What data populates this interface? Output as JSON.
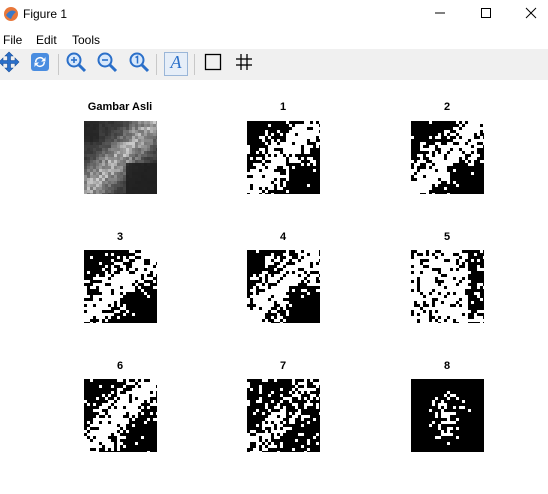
{
  "window": {
    "title": "Figure 1",
    "icons": {
      "app": "matlab-figure-icon",
      "minimize": "minimize-icon",
      "maximize": "maximize-icon",
      "close": "close-icon"
    }
  },
  "menu": {
    "items": [
      "File",
      "Edit",
      "Tools"
    ]
  },
  "toolbar": {
    "buttons": [
      {
        "name": "pan-icon"
      },
      {
        "name": "rotate-icon"
      },
      {
        "name": "zoom-in-icon"
      },
      {
        "name": "zoom-out-icon"
      },
      {
        "name": "reset-zoom-icon"
      },
      {
        "name": "text-tool-icon"
      },
      {
        "name": "box-icon"
      },
      {
        "name": "grid-icon"
      }
    ]
  },
  "figure": {
    "subplots": [
      {
        "title": "Gambar Asli",
        "kind": "grayscale"
      },
      {
        "title": "1",
        "kind": "binary"
      },
      {
        "title": "2",
        "kind": "binary"
      },
      {
        "title": "3",
        "kind": "binary"
      },
      {
        "title": "4",
        "kind": "binary"
      },
      {
        "title": "5",
        "kind": "binary"
      },
      {
        "title": "6",
        "kind": "binary"
      },
      {
        "title": "7",
        "kind": "binary"
      },
      {
        "title": "8",
        "kind": "binary"
      }
    ]
  },
  "colors": {
    "toolbar_bg": "#f0f0f0",
    "icon_blue": "#2a6fc9",
    "figure_bg": "#ffffff"
  }
}
